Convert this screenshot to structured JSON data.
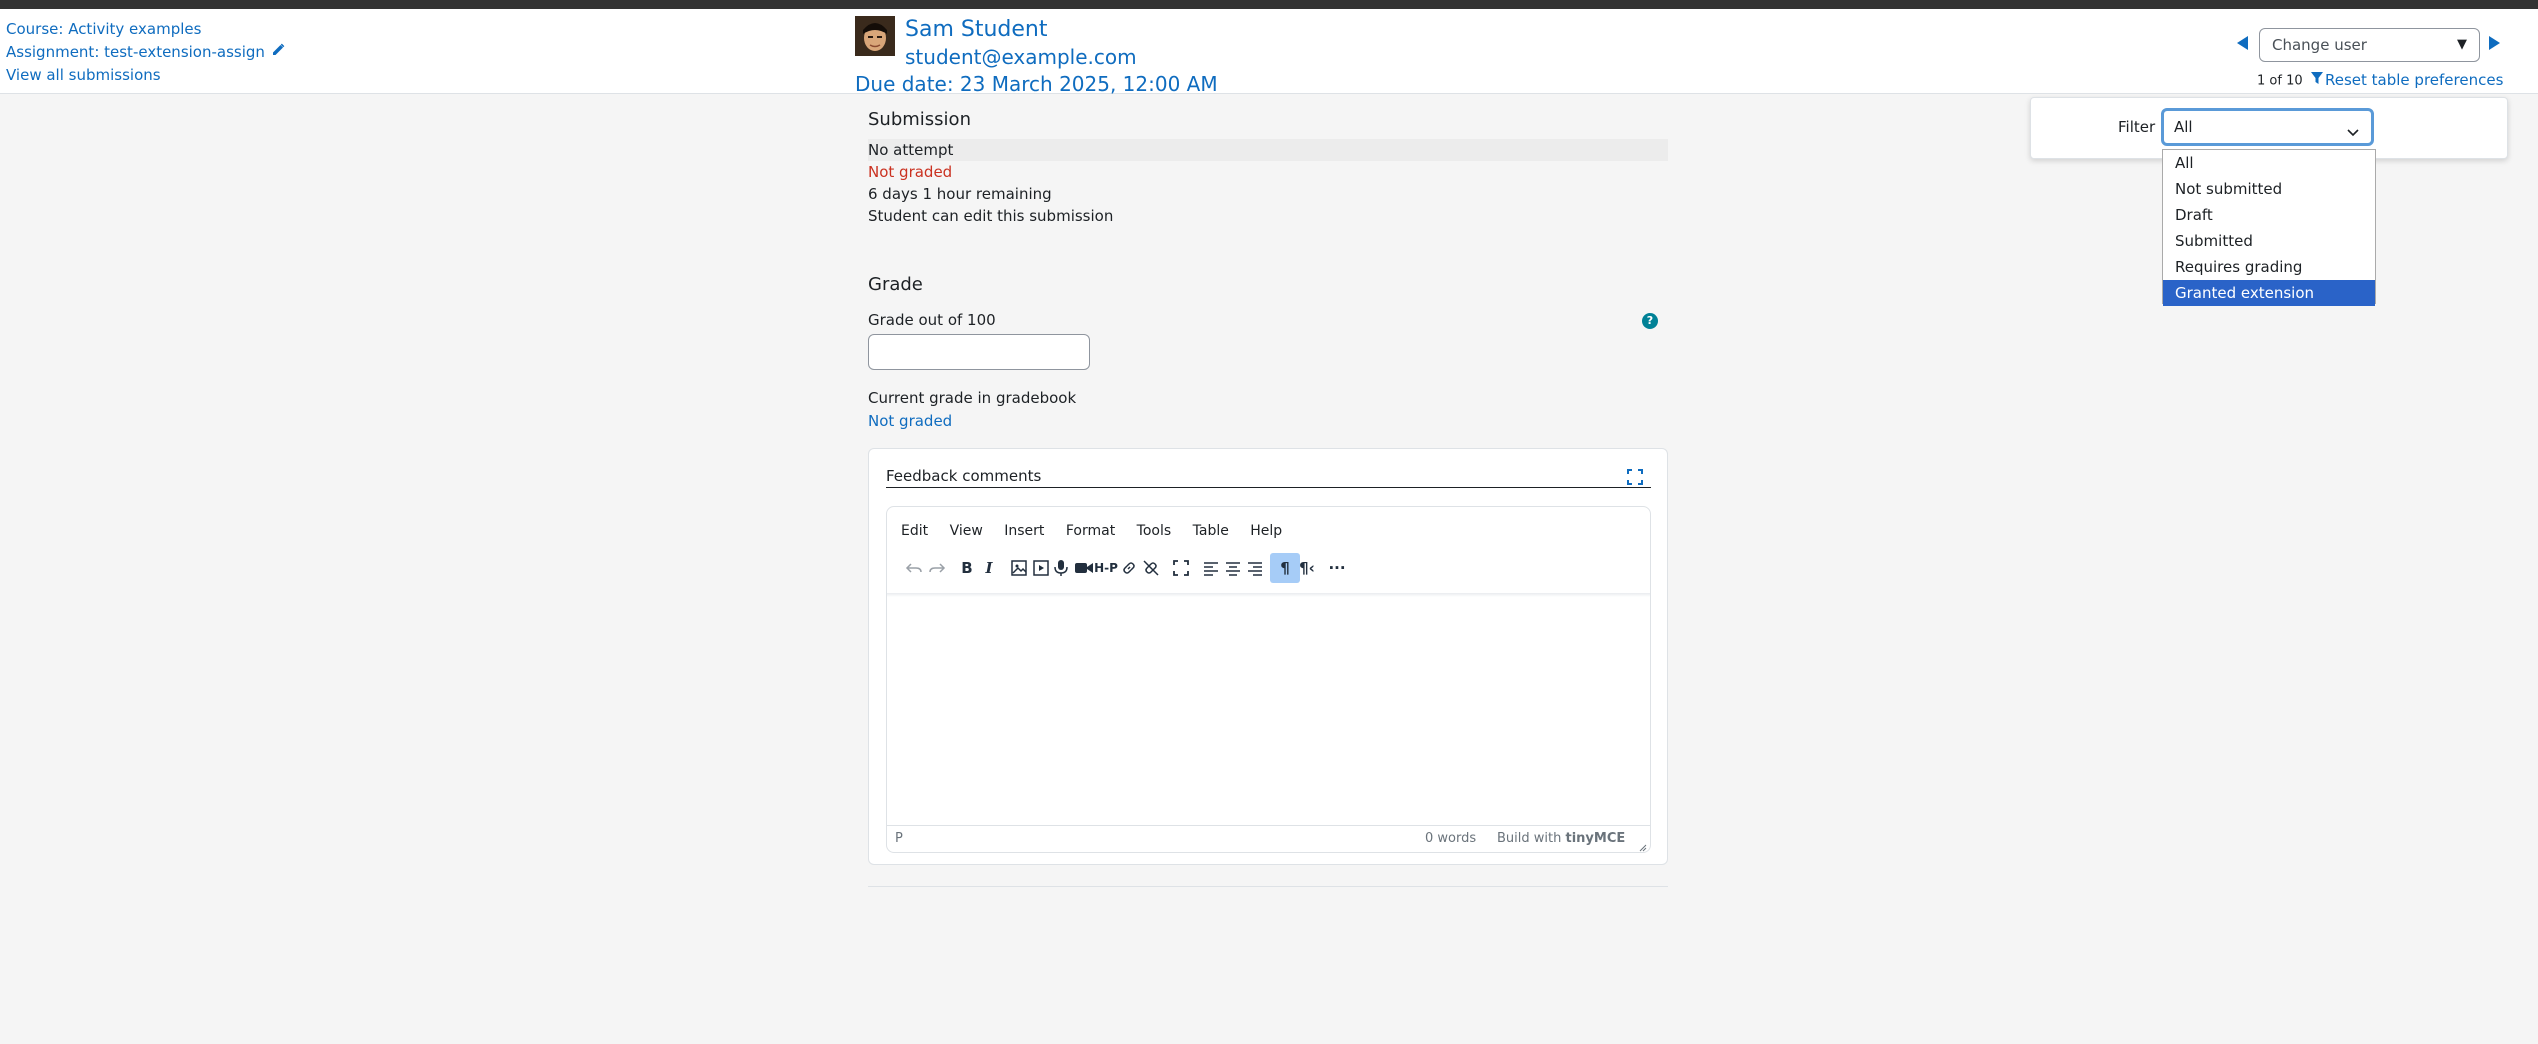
{
  "header": {
    "course_link": "Course: Activity examples",
    "assignment_link": "Assignment: test-extension-assign",
    "view_all_link": "View all submissions",
    "user_name": "Sam Student",
    "user_email": "student@example.com",
    "due_date": "Due date: 23 March 2025, 12:00 AM",
    "change_user_placeholder": "Change user",
    "pager_text": "1 of 10",
    "reset_prefs": "Reset table preferences"
  },
  "submission": {
    "heading": "Submission",
    "status": "No attempt",
    "grading_status": "Not graded",
    "time_remaining": "6 days 1 hour remaining",
    "edit_status": "Student can edit this submission"
  },
  "grade": {
    "heading": "Grade",
    "grade_label": "Grade out of 100",
    "grade_value": "",
    "current_label": "Current grade in gradebook",
    "current_value": "Not graded"
  },
  "feedback": {
    "title": "Feedback comments",
    "menus": [
      "Edit",
      "View",
      "Insert",
      "Format",
      "Tools",
      "Table",
      "Help"
    ],
    "status_path": "P",
    "word_count": "0 words",
    "branding_prefix": "Build with",
    "branding_name": "tinyMCE"
  },
  "filter": {
    "label": "Filter",
    "selected": "All",
    "options": [
      "All",
      "Not submitted",
      "Draft",
      "Submitted",
      "Requires grading",
      "Granted extension"
    ],
    "highlighted": "Granted extension"
  },
  "colors": {
    "link": "#0f6cbf",
    "danger": "#ca3120",
    "highlight": "#2a63c8"
  }
}
